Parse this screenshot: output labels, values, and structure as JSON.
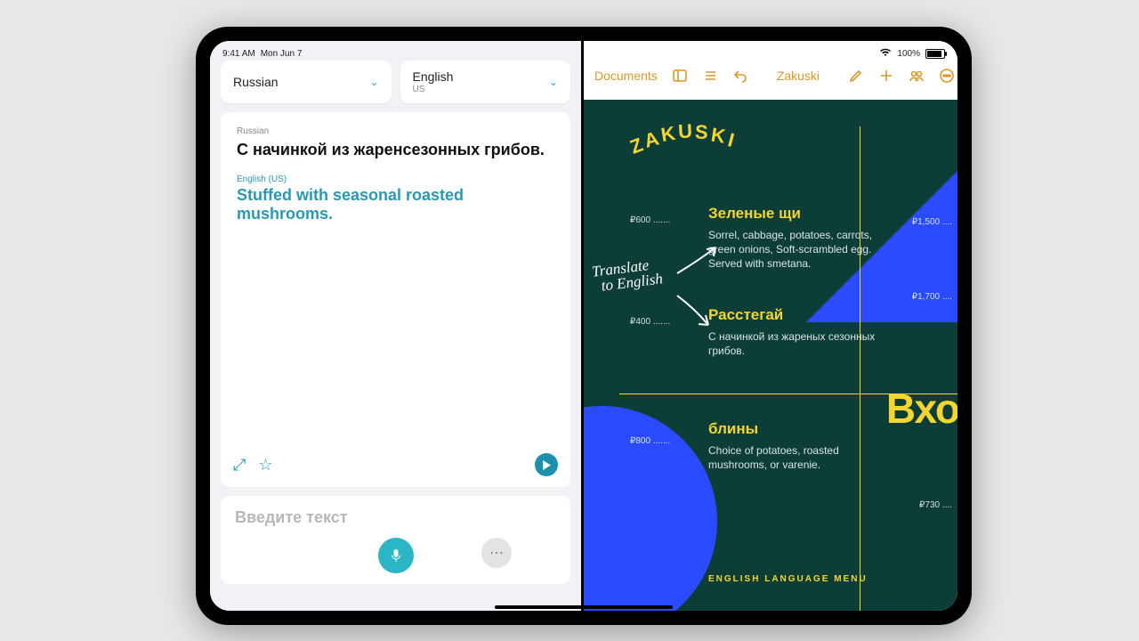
{
  "status": {
    "time": "9:41 AM",
    "date": "Mon Jun 7",
    "battery": "100%"
  },
  "translate": {
    "langFrom": {
      "primary": "Russian"
    },
    "langTo": {
      "primary": "English",
      "secondary": "US"
    },
    "sourceLabel": "Russian",
    "sourceText": "С начинкой из жаренсезонных грибов.",
    "targetLabel": "English (US)",
    "targetText": "Stuffed with seasonal roasted mushrooms.",
    "placeholder": "Введите текст"
  },
  "docs": {
    "back": "Documents",
    "title": "Zakuski",
    "heading": "ZAKUSKI",
    "items": [
      {
        "name": "Зеленые щи",
        "desc": "Sorrel, cabbage, potatoes, carrots, green onions, Soft-scrambled egg. Served with smetana.",
        "price": "₽600 ......."
      },
      {
        "name": "Расстегай",
        "desc": "С начинкой из жареных сезонных грибов.",
        "price": "₽400 ......."
      },
      {
        "name": "блины",
        "desc": "Choice of potatoes, roasted mushrooms, or varenie.",
        "price": "₽800 ......."
      }
    ],
    "sidePrices": [
      "₽1,500 ....",
      "₽1,700 ....",
      "₽730 ...."
    ],
    "big": "Вхо",
    "menuTag": "ENGLISH LANGUAGE MENU",
    "annotation": "Translate\nto English"
  }
}
